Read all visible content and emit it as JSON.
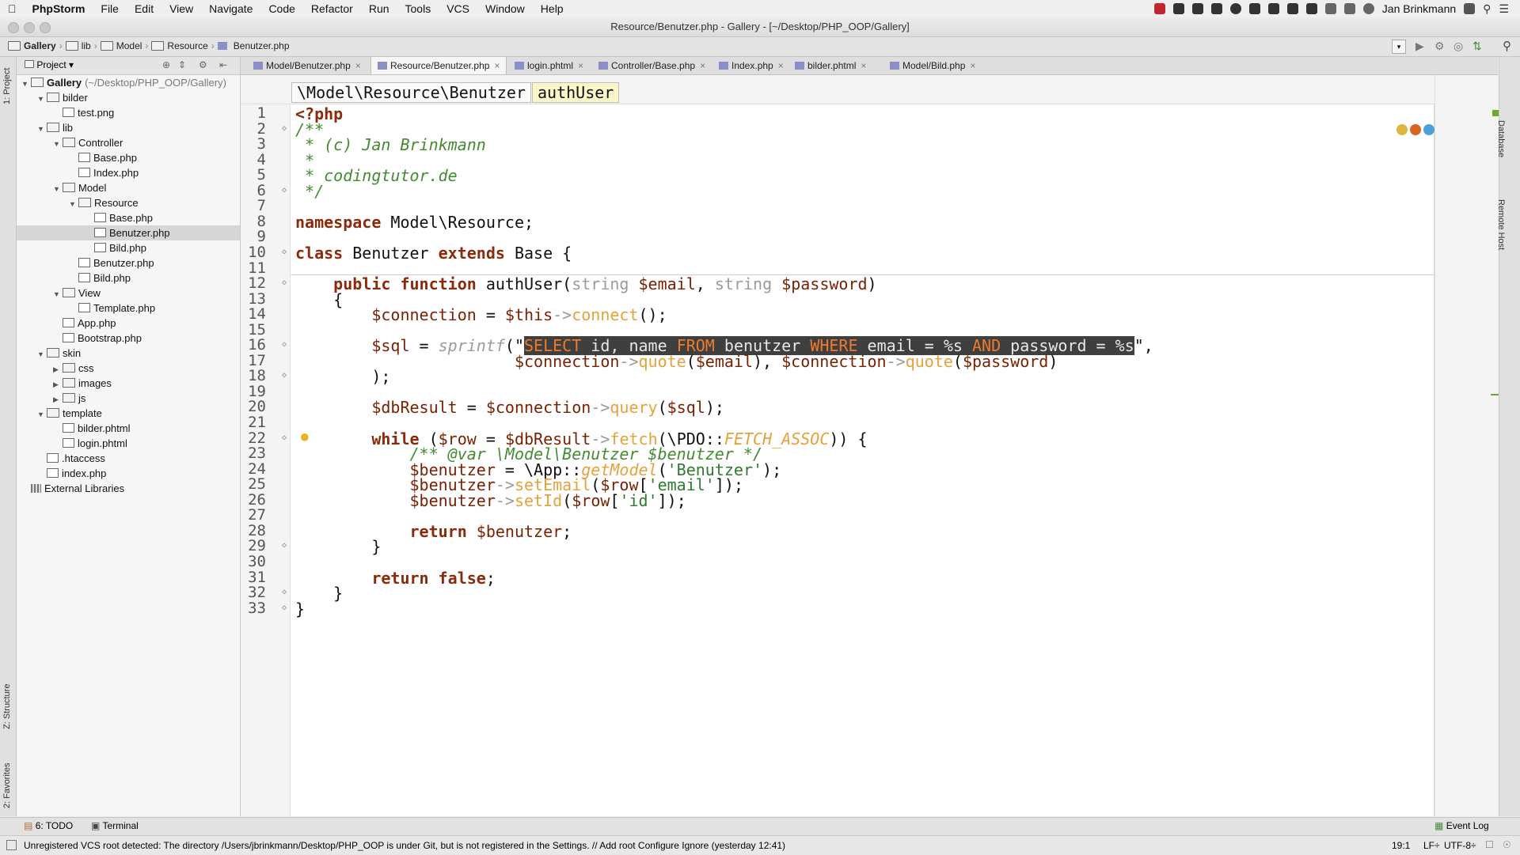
{
  "menubar": {
    "app": "PhpStorm",
    "items": [
      "File",
      "Edit",
      "View",
      "Navigate",
      "Code",
      "Refactor",
      "Run",
      "Tools",
      "VCS",
      "Window",
      "Help"
    ],
    "user": "Jan Brinkmann"
  },
  "window": {
    "title": "Resource/Benutzer.php - Gallery - [~/Desktop/PHP_OOP/Gallery]"
  },
  "navbar": {
    "crumbs": [
      "Gallery",
      "lib",
      "Model",
      "Resource",
      "Benutzer.php"
    ]
  },
  "left_strip": {
    "project": "1: Project",
    "structure": "Z: Structure",
    "favorites": "2: Favorites"
  },
  "project_panel": {
    "header": "Project",
    "tree": [
      {
        "label": "Gallery",
        "suffix": "(~/Desktop/PHP_OOP/Gallery)",
        "type": "folder",
        "depth": 0,
        "open": true
      },
      {
        "label": "bilder",
        "type": "folder",
        "depth": 1,
        "open": true
      },
      {
        "label": "test.png",
        "type": "file",
        "depth": 2
      },
      {
        "label": "lib",
        "type": "folder",
        "depth": 1,
        "open": true
      },
      {
        "label": "Controller",
        "type": "folder",
        "depth": 2,
        "open": true
      },
      {
        "label": "Base.php",
        "type": "file",
        "depth": 3
      },
      {
        "label": "Index.php",
        "type": "file",
        "depth": 3
      },
      {
        "label": "Model",
        "type": "folder",
        "depth": 2,
        "open": true
      },
      {
        "label": "Resource",
        "type": "folder",
        "depth": 3,
        "open": true
      },
      {
        "label": "Base.php",
        "type": "file",
        "depth": 4
      },
      {
        "label": "Benutzer.php",
        "type": "file",
        "depth": 4,
        "selected": true
      },
      {
        "label": "Bild.php",
        "type": "file",
        "depth": 4
      },
      {
        "label": "Benutzer.php",
        "type": "file",
        "depth": 3
      },
      {
        "label": "Bild.php",
        "type": "file",
        "depth": 3
      },
      {
        "label": "View",
        "type": "folder",
        "depth": 2,
        "open": true
      },
      {
        "label": "Template.php",
        "type": "file",
        "depth": 3
      },
      {
        "label": "App.php",
        "type": "file",
        "depth": 2
      },
      {
        "label": "Bootstrap.php",
        "type": "file",
        "depth": 2
      },
      {
        "label": "skin",
        "type": "folder",
        "depth": 1,
        "open": true
      },
      {
        "label": "css",
        "type": "folder",
        "depth": 2,
        "open": false
      },
      {
        "label": "images",
        "type": "folder",
        "depth": 2,
        "open": false
      },
      {
        "label": "js",
        "type": "folder",
        "depth": 2,
        "open": false
      },
      {
        "label": "template",
        "type": "folder",
        "depth": 1,
        "open": true
      },
      {
        "label": "bilder.phtml",
        "type": "file",
        "depth": 2
      },
      {
        "label": "login.phtml",
        "type": "file",
        "depth": 2
      },
      {
        "label": ".htaccess",
        "type": "file",
        "depth": 1
      },
      {
        "label": "index.php",
        "type": "file",
        "depth": 1
      },
      {
        "label": "External Libraries",
        "type": "lib",
        "depth": 0
      }
    ]
  },
  "tabs": [
    "Model/Benutzer.php",
    "Resource/Benutzer.php",
    "login.phtml",
    "Controller/Base.php",
    "Index.php",
    "bilder.phtml",
    "Model/Bild.php"
  ],
  "active_tab": 1,
  "editor_breadcrumb": {
    "namespace": "\\Model\\Resource\\Benutzer",
    "method": "authUser"
  },
  "code_lines": [
    "<?php",
    "/**",
    " * (c) Jan Brinkmann",
    " *",
    " * codingtutor.de",
    " */",
    "",
    "namespace Model\\Resource;",
    "",
    "class Benutzer extends Base {",
    "",
    "    public function authUser(string $email, string $password)",
    "    {",
    "        $connection = $this->connect();",
    "",
    "        $sql = sprintf(\"SELECT id, name FROM benutzer WHERE email = %s AND password = %s\",",
    "                       $connection->quote($email), $connection->quote($password)",
    "        );",
    "",
    "        $dbResult = $connection->query($sql);",
    "",
    "        while ($row = $dbResult->fetch(\\PDO::FETCH_ASSOC)) {",
    "            /** @var \\Model\\Benutzer $benutzer */",
    "            $benutzer = \\App::getModel('Benutzer');",
    "            $benutzer->setEmail($row['email']);",
    "            $benutzer->setId($row['id']);",
    "",
    "            return $benutzer;",
    "        }",
    "",
    "        return false;",
    "    }",
    "}"
  ],
  "right_strip": {
    "database": "Database",
    "remote": "Remote Host"
  },
  "bottom_tools": {
    "todo": "6: TODO",
    "terminal": "Terminal",
    "event_log": "Event Log"
  },
  "status": {
    "message": "Unregistered VCS root detected: The directory /Users/jbrinkmann/Desktop/PHP_OOP is under Git, but is not registered in the Settings. // Add root  Configure  Ignore (yesterday 12:41)",
    "position": "19:1",
    "line_sep": "LF÷",
    "encoding": "UTF-8÷"
  }
}
